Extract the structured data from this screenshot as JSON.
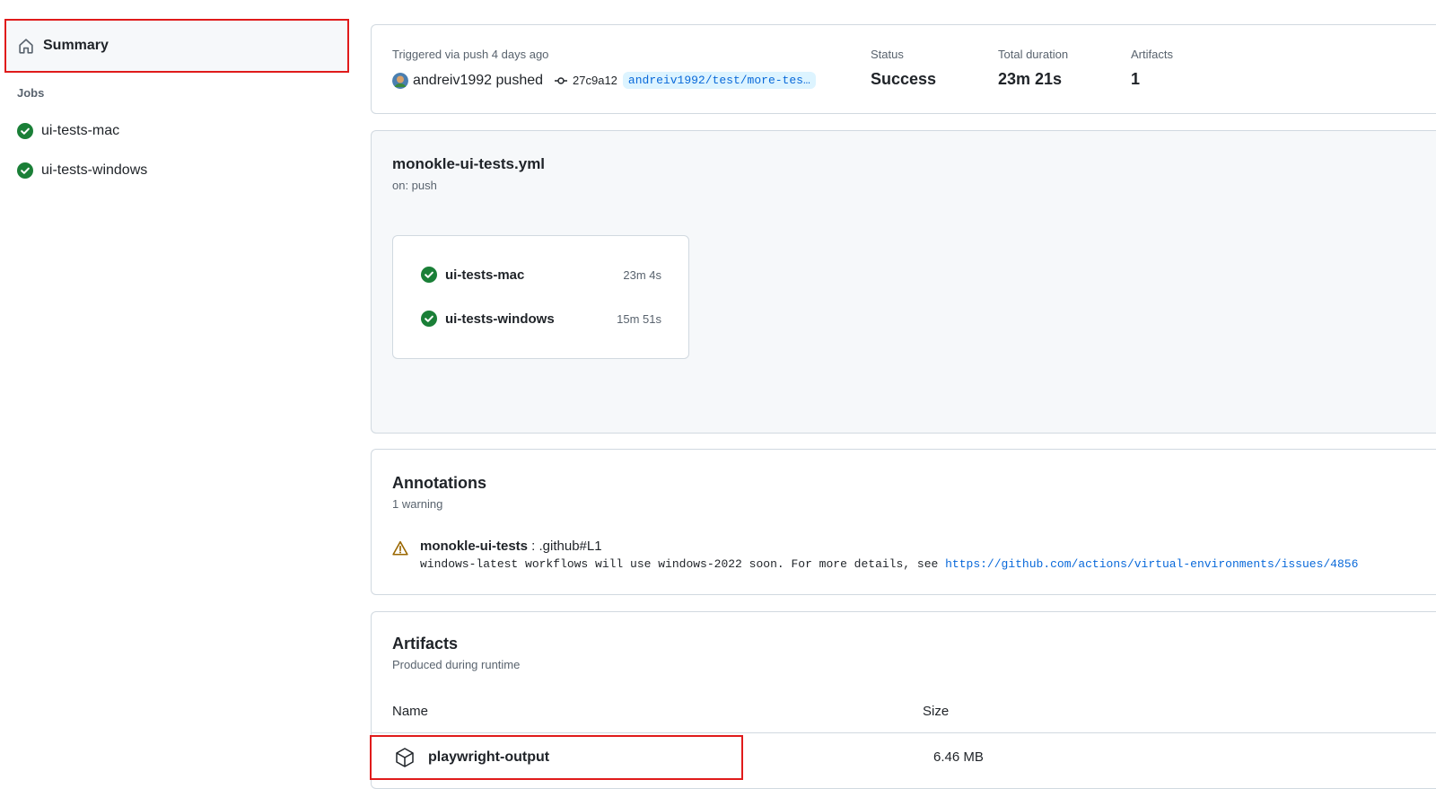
{
  "sidebar": {
    "summary_label": "Summary",
    "jobs_heading": "Jobs",
    "jobs": [
      {
        "label": "ui-tests-mac",
        "status": "success"
      },
      {
        "label": "ui-tests-windows",
        "status": "success"
      }
    ]
  },
  "run": {
    "trigger_text": "Triggered via push 4 days ago",
    "actor": "andreiv1992",
    "action": "pushed",
    "commit_sha": "27c9a12",
    "branch": "andreiv1992/test/more-tes…",
    "status_label": "Status",
    "status_value": "Success",
    "duration_label": "Total duration",
    "duration_value": "23m 21s",
    "artifacts_label": "Artifacts",
    "artifacts_value": "1"
  },
  "workflow": {
    "file": "monokle-ui-tests.yml",
    "trigger": "on: push",
    "jobs": [
      {
        "name": "ui-tests-mac",
        "duration": "23m 4s"
      },
      {
        "name": "ui-tests-windows",
        "duration": "15m 51s"
      }
    ]
  },
  "annotations": {
    "title": "Annotations",
    "count_text": "1 warning",
    "items": [
      {
        "job": "monokle-ui-tests",
        "location": " : .github#L1",
        "message": "windows-latest workflows will use windows-2022 soon. For more details, see ",
        "link": "https://github.com/actions/virtual-environments/issues/4856"
      }
    ]
  },
  "artifacts": {
    "title": "Artifacts",
    "subtitle": "Produced during runtime",
    "col_name": "Name",
    "col_size": "Size",
    "items": [
      {
        "name": "playwright-output",
        "size": "6.46 MB"
      }
    ]
  },
  "colors": {
    "success": "#1a7f37",
    "link": "#0969da",
    "warning": "#9a6700",
    "highlight": "#e01b1b"
  },
  "icons": [
    "home-icon",
    "check-circle-icon",
    "commit-icon",
    "alert-icon",
    "package-icon"
  ]
}
